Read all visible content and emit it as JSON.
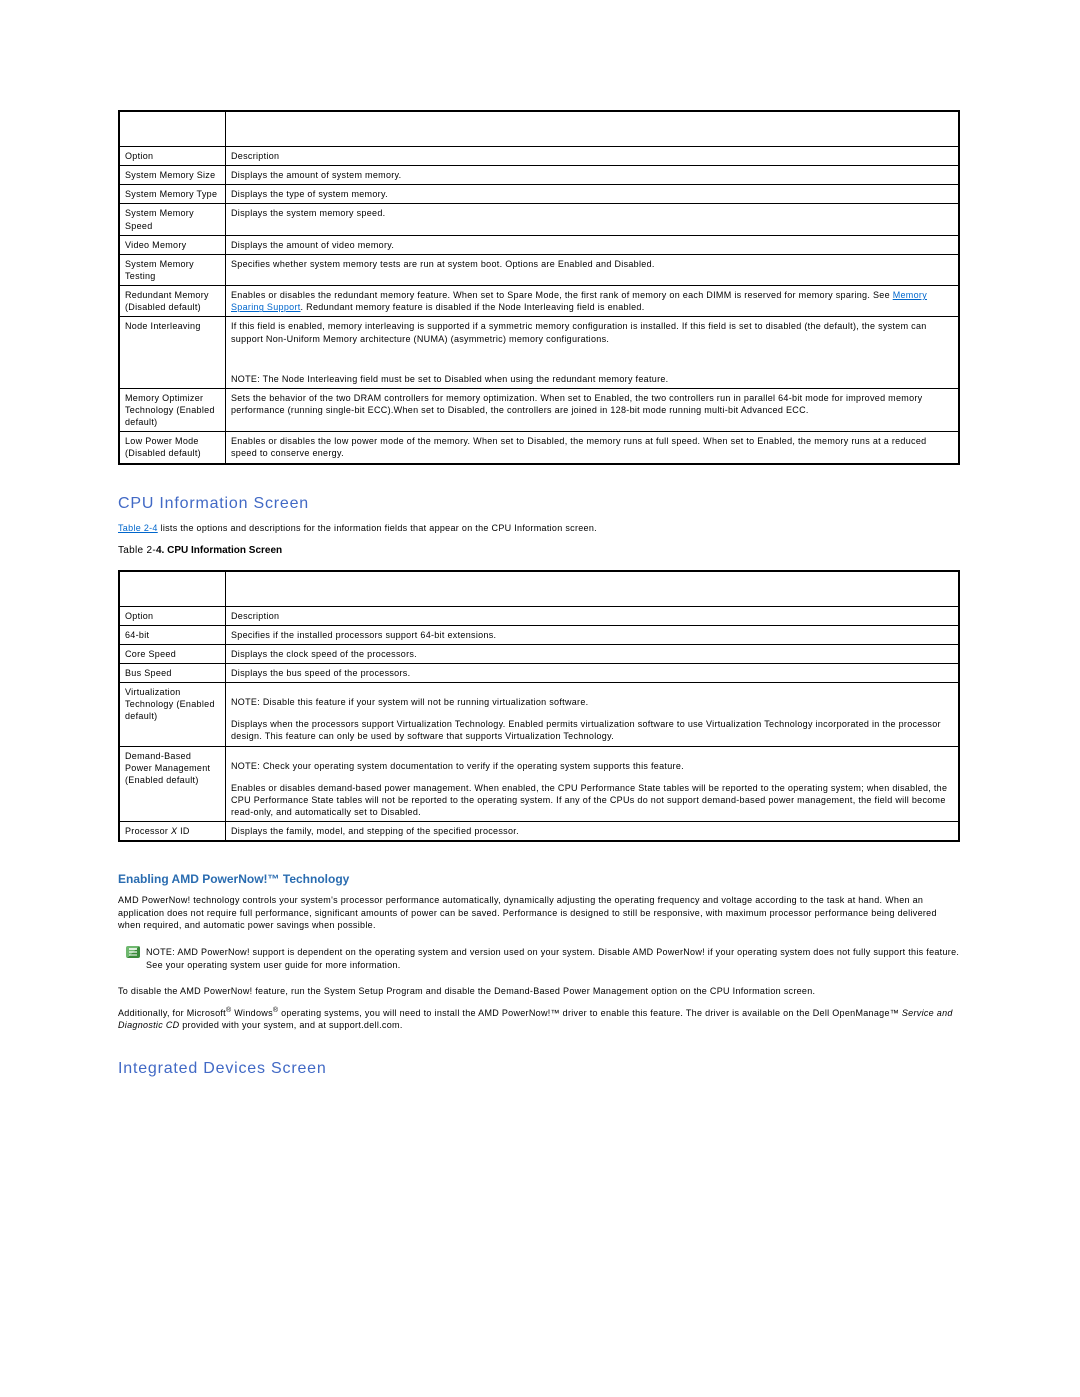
{
  "table1": {
    "headers": {
      "option": "Option",
      "description": "Description"
    },
    "rows": [
      {
        "option": "System Memory Size",
        "desc": "Displays the amount of system memory."
      },
      {
        "option": "System Memory Type",
        "desc": "Displays the type of system memory."
      },
      {
        "option": "System Memory Speed",
        "desc": "Displays the system memory speed."
      },
      {
        "option": "Video Memory",
        "desc": "Displays the amount of video memory."
      },
      {
        "option": "System Memory Testing",
        "desc": "Specifies whether system memory tests are run at system boot. Options are Enabled and Disabled."
      },
      {
        "option": "Redundant Memory (Disabled default)",
        "desc_pre": "Enables or disables the redundant memory feature. When set to Spare Mode, the first rank of memory on each DIMM is reserved for memory sparing. See ",
        "link": "Memory Sparing Support",
        "desc_post": ". Redundant memory feature is disabled if the Node Interleaving field is enabled."
      },
      {
        "option": "Node Interleaving",
        "desc": "If this field is enabled, memory interleaving is supported if a symmetric memory configuration is installed. If this field is set to disabled (the default), the system can support Non-Uniform Memory architecture (NUMA) (asymmetric) memory configurations.",
        "note_label": "NOTE:",
        "note": "The Node Interleaving field must be set to Disabled when using the redundant memory feature."
      },
      {
        "option": "Memory Optimizer Technology (Enabled default)",
        "desc": "Sets the behavior of the two DRAM controllers for memory optimization. When set to Enabled, the two controllers run in parallel 64-bit mode for improved memory performance (running single-bit ECC).When set to Disabled, the controllers are joined in 128-bit mode running multi-bit Advanced ECC."
      },
      {
        "option": "Low Power Mode (Disabled default)",
        "desc": "Enables or disables the low power mode of the memory. When set to Disabled, the memory runs at full speed. When set to Enabled, the memory runs at a reduced speed to conserve energy."
      }
    ]
  },
  "section_cpu": {
    "title": "CPU Information Screen",
    "intro_link": "Table 2-4",
    "intro_rest": " lists the options and descriptions for the information fields that appear on the CPU Information screen.",
    "caption_prefix": "Table 2-",
    "caption_bold": "4. CPU Information Screen"
  },
  "table2": {
    "headers": {
      "option": "Option",
      "description": "Description"
    },
    "rows": [
      {
        "option": "64-bit",
        "desc": "Specifies if the installed processors support 64-bit extensions."
      },
      {
        "option": "Core Speed",
        "desc": "Displays the clock speed of the processors."
      },
      {
        "option": "Bus Speed",
        "desc": "Displays the bus speed of the processors."
      },
      {
        "option": "Virtualization Technology (Enabled default)",
        "note_label": "NOTE:",
        "note": "Disable this feature if your system will not be running virtualization software.",
        "desc": "Displays when the processors support Virtualization Technology. Enabled permits virtualization software to use Virtualization Technology incorporated in the processor design. This feature can only be used by software that supports Virtualization Technology."
      },
      {
        "option": "Demand-Based Power Management (Enabled default)",
        "note_label": "NOTE:",
        "note": "Check your operating system documentation to verify if the operating system supports this feature.",
        "desc": "Enables or disables demand-based power management. When enabled, the CPU Performance State tables will be reported to the operating system; when disabled, the CPU Performance State tables will not be reported to the operating system. If any of the CPUs do not support demand-based power management, the field will become read-only, and automatically set to Disabled."
      },
      {
        "option_pre": "Processor ",
        "option_italic": "X ",
        "option_post": "ID",
        "desc": "Displays the family, model, and stepping of the specified processor."
      }
    ]
  },
  "amd": {
    "title": "Enabling AMD PowerNow!™ Technology",
    "p1": "AMD PowerNow! technology controls your system's processor performance automatically, dynamically adjusting the operating frequency and voltage according to the task at hand. When an application does not require full performance, significant amounts of power can be saved. Performance is designed to still be responsive, with maximum processor performance being delivered when required, and automatic power savings when possible.",
    "note_label": "NOTE:",
    "note": "AMD PowerNow! support is dependent on the operating system and version used on your system. Disable AMD PowerNow! if your operating system does not fully support this feature. See your operating system user guide for more information.",
    "p2": "To disable the AMD PowerNow! feature, run the System Setup Program and disable the Demand-Based Power Management option on the CPU Information screen.",
    "p3_pre": "Additionally, for Microsoft",
    "p3_mid1": " Windows",
    "p3_mid2": " operating systems, you will need to install the AMD PowerNow!™ driver to enable this feature. The driver is available on the Dell OpenManage™ ",
    "p3_italic": "Service and Diagnostic CD",
    "p3_post": " provided with your system, and at support.dell.com."
  },
  "section_integrated": {
    "title": "Integrated Devices Screen"
  }
}
